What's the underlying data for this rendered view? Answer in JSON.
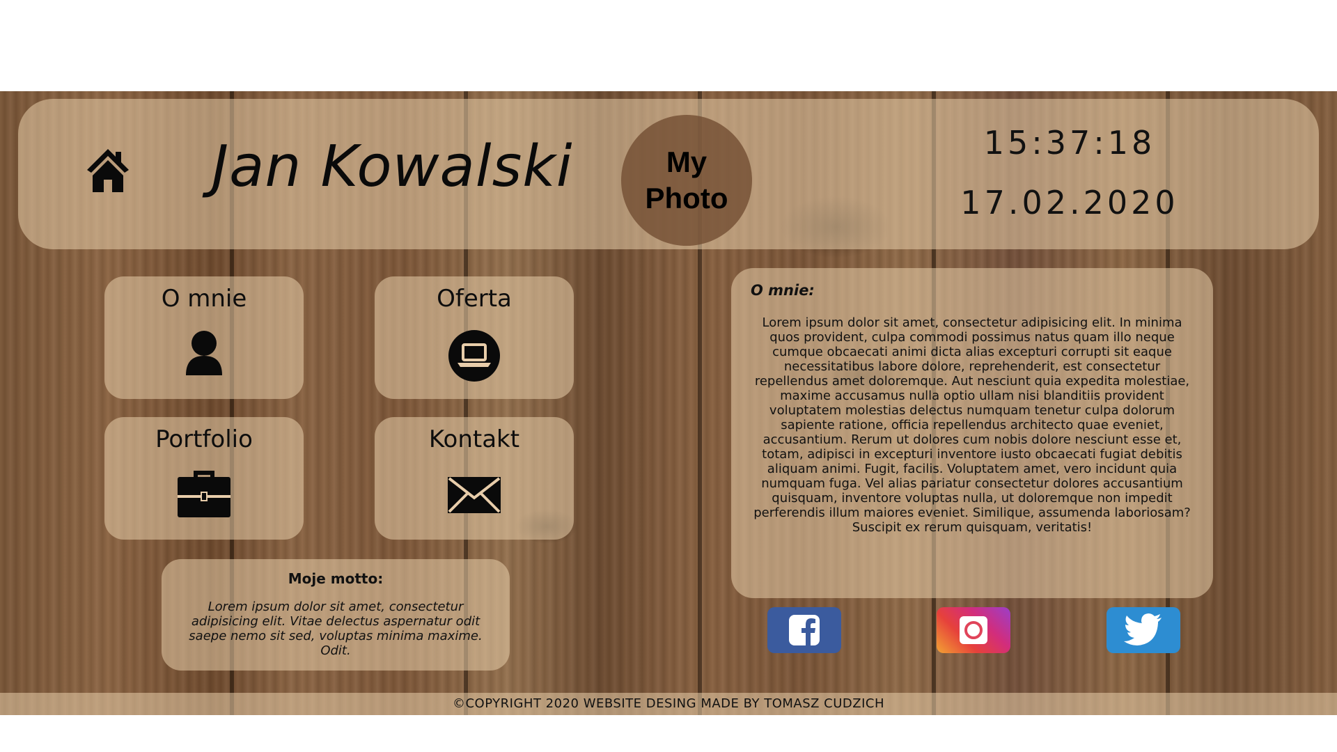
{
  "header": {
    "name": "Jan Kowalski",
    "photo_label": "My\nPhoto",
    "clock": "15:37:18",
    "date": "17.02.2020"
  },
  "icons": {
    "home": "home-icon",
    "o_mnie": "user-icon",
    "oferta": "laptop-icon",
    "portfolio": "briefcase-icon",
    "kontakt": "envelope-icon",
    "facebook": "facebook-icon",
    "instagram": "instagram-icon",
    "twitter": "twitter-icon"
  },
  "nav": {
    "o_mnie": "O mnie",
    "oferta": "Oferta",
    "portfolio": "Portfolio",
    "kontakt": "Kontakt"
  },
  "motto": {
    "title": "Moje motto:",
    "text": "Lorem ipsum dolor sit amet, consectetur adipisicing elit. Vitae delectus aspernatur odit saepe nemo sit sed, voluptas minima maxime. Odit."
  },
  "about": {
    "title": "O mnie:",
    "text": "Lorem ipsum dolor sit amet, consectetur adipisicing elit. In minima quos provident, culpa commodi possimus natus quam illo neque cumque obcaecati animi dicta alias excepturi corrupti sit eaque necessitatibus labore dolore, reprehenderit, est consectetur repellendus amet doloremque. Aut nesciunt quia expedita molestiae, maxime accusamus nulla optio ullam nisi blanditiis provident voluptatem molestias delectus numquam tenetur culpa dolorum sapiente ratione, officia repellendus architecto quae eveniet, accusantium. Rerum ut dolores cum nobis dolore nesciunt esse et, totam, adipisci in excepturi inventore iusto obcaecati fugiat debitis aliquam animi. Fugit, facilis. Voluptatem amet, vero incidunt quia numquam fuga. Vel alias pariatur consectetur dolores accusantium quisquam, inventore voluptas nulla, ut doloremque non impedit perferendis illum maiores eveniet. Similique, assumenda laboriosam? Suscipit ex rerum quisquam, veritatis!"
  },
  "footer": {
    "copyright": "©COPYRIGHT 2020 WEBSITE DESING MADE BY TOMASZ CUDZICH"
  },
  "colors": {
    "facebook": "#3b5b9e",
    "twitter": "#2d8dd2",
    "panel": "#e8cdaa"
  }
}
